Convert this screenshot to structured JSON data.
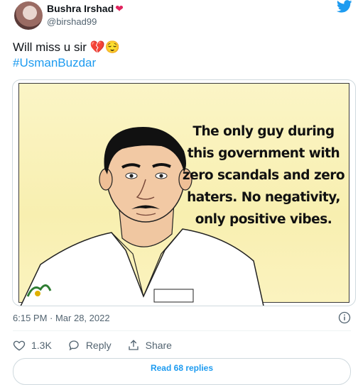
{
  "author": {
    "name": "Bushra Irshad",
    "name_emoji": "❤",
    "handle": "@birshad99"
  },
  "tweet": {
    "text": "Will miss u sir",
    "text_emojis": "💔😌",
    "hashtag": "#UsmanBuzdar"
  },
  "media": {
    "quote": "The only guy during this government with zero scandals and zero haters. No negativity, only positive vibes."
  },
  "meta": {
    "timestamp": "6:15 PM · Mar 28, 2022"
  },
  "actions": {
    "like_count": "1.3K",
    "reply_label": "Reply",
    "share_label": "Share"
  },
  "read_replies_label": "Read 68 replies",
  "colors": {
    "accent": "#1d9bf0",
    "heart": "#e0245e",
    "muted": "#536471"
  },
  "icons": [
    "twitter-bird-icon",
    "info-icon",
    "heart-icon",
    "reply-icon",
    "share-icon"
  ]
}
